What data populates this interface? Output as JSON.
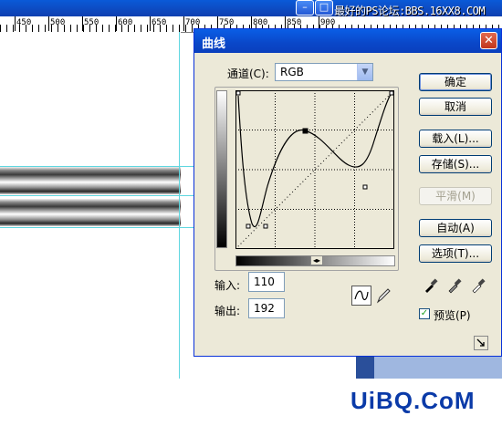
{
  "watermark_top": "最好的PS论坛:BBS.16XX8.COM",
  "watermark_bottom": "UiBQ.CoM",
  "ruler": {
    "labels": [
      "450",
      "500",
      "550",
      "600",
      "650",
      "700",
      "750",
      "800",
      "850",
      "900"
    ]
  },
  "dialog": {
    "title": "曲线",
    "channel_label": "通道(C):",
    "channel_value": "RGB",
    "input_label": "输入:",
    "input_value": "110",
    "output_label": "输出:",
    "output_value": "192",
    "buttons": {
      "ok": "确定",
      "cancel": "取消",
      "load": "载入(L)...",
      "save": "存储(S)...",
      "smooth": "平滑(M)",
      "auto": "自动(A)",
      "options": "选项(T)..."
    },
    "preview_label": "预览(P)",
    "preview_checked": true
  },
  "colors": {
    "titlebar": "#0a47c8",
    "dialog_bg": "#ece9d8",
    "guide": "#5fd7e0"
  }
}
